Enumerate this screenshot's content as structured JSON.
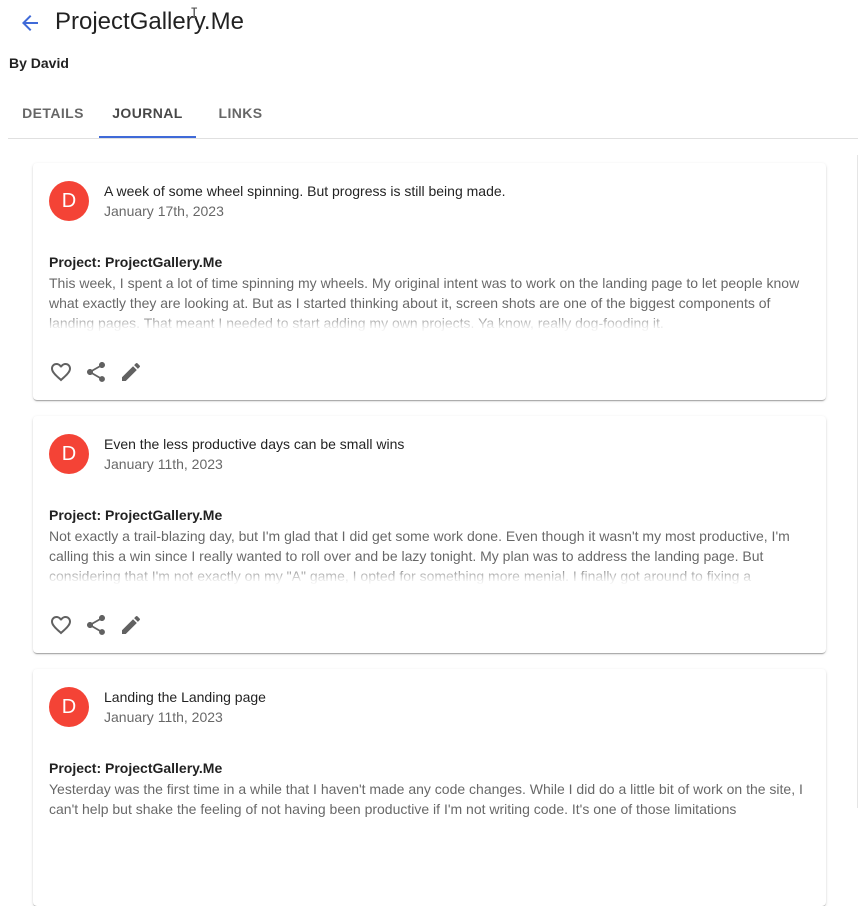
{
  "header": {
    "title": "ProjectGallery.Me",
    "byline": "By David",
    "cursor": "I"
  },
  "tabs": [
    {
      "label": "DETAILS",
      "active": false
    },
    {
      "label": "JOURNAL",
      "active": true
    },
    {
      "label": "LINKS",
      "active": false
    }
  ],
  "colors": {
    "accent": "#3f6ad8",
    "avatar": "#f44336"
  },
  "icons": {
    "back": "arrow-back-icon",
    "like": "heart-outline-icon",
    "share": "share-icon",
    "edit": "pencil-icon"
  },
  "entries": [
    {
      "avatar_letter": "D",
      "title": "A week of some wheel spinning. But progress is still being made.",
      "date": "January 17th, 2023",
      "project": "Project: ProjectGallery.Me",
      "excerpt": "This week, I spent a lot of time spinning my wheels. My original intent was to work on the landing page to let people know what exactly they are looking at. But as I started thinking about it, screen shots are one of the biggest components of landing pages. That meant I needed to start adding my own projects. Ya know, really dog-fooding it."
    },
    {
      "avatar_letter": "D",
      "title": "Even the less productive days can be small wins",
      "date": "January 11th, 2023",
      "project": "Project: ProjectGallery.Me",
      "excerpt": "Not exactly a trail-blazing day, but I'm glad that I did get some work done. Even though it wasn't my most productive, I'm calling this a win since I really wanted to roll over and be lazy tonight. My plan was to address the landing page. But considering that I'm not exactly on my \"A\" game, I opted for something more menial. I finally got around to fixing a"
    },
    {
      "avatar_letter": "D",
      "title": "Landing the Landing page",
      "date": "January 11th, 2023",
      "project": "Project: ProjectGallery.Me",
      "excerpt": "Yesterday was the first time in a while that I haven't made any code changes. While I did do a little bit of work on the site, I can't help but shake the feeling of not having been productive if I'm not writing code. It's one of those limitations"
    }
  ]
}
